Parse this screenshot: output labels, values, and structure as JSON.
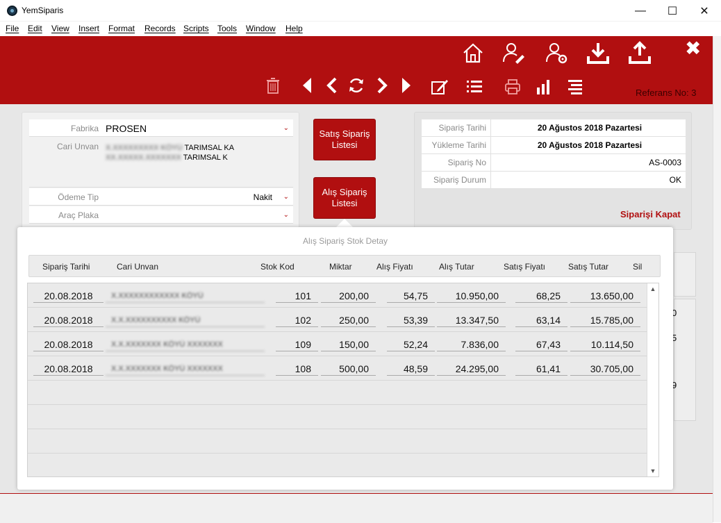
{
  "window": {
    "title": "YemSiparis",
    "minimize": "—",
    "maximize": "☐",
    "close": "✕"
  },
  "menu": [
    "File",
    "Edit",
    "View",
    "Insert",
    "Format",
    "Records",
    "Scripts",
    "Tools",
    "Window",
    "Help"
  ],
  "toolbar": {
    "reference_label": "Referans No: 3",
    "close_glyph": "✖"
  },
  "order_form": {
    "fabrika_label": "Fabrika",
    "fabrika_value": "PROSEN",
    "cari_unvan_label": "Cari Unvan",
    "cari_unvan_line1_hidden": "X.XXXXXXXXX KÖYÜ",
    "cari_unvan_line1_visible": "TARIMSAL KA",
    "cari_unvan_line2_hidden": "XX.XXXXX.XXXXXXX",
    "cari_unvan_line2_visible": "TARIMSAL  K",
    "odeme_tip_label": "Ödeme Tip",
    "odeme_tip_value": "Nakit",
    "arac_plaka_label": "Araç Plaka",
    "arac_plaka_value": ""
  },
  "buttons": {
    "satis_siparis": "Satış Sipariş Listesi",
    "alis_siparis": "Alış Sipariş Listesi"
  },
  "order_info": {
    "rows": [
      {
        "label": "Sipariş Tarihi",
        "value": "20 Ağustos 2018 Pazartesi"
      },
      {
        "label": "Yükleme Tarihi",
        "value": "20 Ağustos 2018 Pazartesi"
      },
      {
        "label": "Sipariş No",
        "value": "AS-0003"
      },
      {
        "label": "Sipariş Durum",
        "value": "OK"
      }
    ],
    "kapat_label": "Siparişi Kapat"
  },
  "popup": {
    "title": "Alış Sipariş Stok Detay",
    "columns": [
      "Sipariş Tarihi",
      "Cari Unvan",
      "Stok Kod",
      "Miktar",
      "Alış Fiyatı",
      "Alış Tutar",
      "Satış Fiyatı",
      "Satış Tutar",
      "Sil"
    ],
    "rows": [
      {
        "tarih": "20.08.2018",
        "cari": "X.XXXXXXXXXXXX KÖYÜ",
        "stok": "101",
        "miktar": "200,00",
        "alis_fiyat": "54,75",
        "alis_tutar": "10.950,00",
        "satis_fiyat": "68,25",
        "satis_tutar": "13.650,00"
      },
      {
        "tarih": "20.08.2018",
        "cari": "X.X.XXXXXXXXXX KÖYÜ",
        "stok": "102",
        "miktar": "250,00",
        "alis_fiyat": "53,39",
        "alis_tutar": "13.347,50",
        "satis_fiyat": "63,14",
        "satis_tutar": "15.785,00"
      },
      {
        "tarih": "20.08.2018",
        "cari": "X.X.XXXXXXX KÖYÜ XXXXXXX",
        "stok": "109",
        "miktar": "150,00",
        "alis_fiyat": "52,24",
        "alis_tutar": "7.836,00",
        "satis_fiyat": "67,43",
        "satis_tutar": "10.114,50"
      },
      {
        "tarih": "20.08.2018",
        "cari": "X.X.XXXXXXX KÖYÜ XXXXXXX",
        "stok": "108",
        "miktar": "500,00",
        "alis_fiyat": "48,59",
        "alis_tutar": "24.295,00",
        "satis_fiyat": "61,41",
        "satis_tutar": "30.705,00"
      }
    ],
    "scroll_up": "▲",
    "scroll_down": "▼"
  },
  "background_fragments": [
    "0",
    "5",
    "9"
  ],
  "colors": {
    "brand_red": "#b10f10",
    "panel_gray": "#e7e7e7"
  }
}
